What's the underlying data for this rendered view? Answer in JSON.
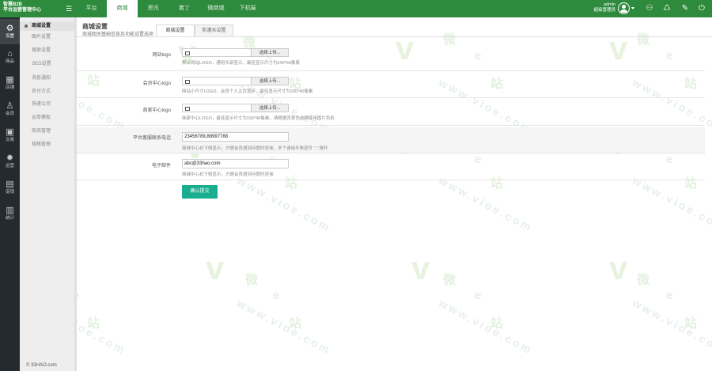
{
  "app": {
    "brand_line1": "智慧B2B",
    "brand_line2": "平台运营管理中心"
  },
  "top_nav": [
    {
      "label": "平台"
    },
    {
      "label": "商城",
      "active": true
    },
    {
      "label": "资讯"
    },
    {
      "label": "着丁"
    },
    {
      "label": "微商城"
    },
    {
      "label": "下机端"
    }
  ],
  "user": {
    "name": "admin",
    "role": "超级管理员"
  },
  "icons": {
    "menu": "menu-icon",
    "user": "user-avatar-icon",
    "a": "person-list-icon",
    "b": "bucket-icon",
    "c": "brush-icon",
    "d": "power-icon"
  },
  "icon_sidebar": [
    {
      "label": "设置",
      "icon": "gear-icon",
      "active": true
    },
    {
      "label": "商品",
      "icon": "shopping-basket-icon"
    },
    {
      "label": "店铺",
      "icon": "store-icon"
    },
    {
      "label": "会员",
      "icon": "user-icon"
    },
    {
      "label": "交易",
      "icon": "trade-icon"
    },
    {
      "label": "运营",
      "icon": "settings-icon"
    },
    {
      "label": "促销",
      "icon": "promotion-icon"
    },
    {
      "label": "统计",
      "icon": "chart-icon"
    }
  ],
  "sub_menu": [
    {
      "label": "商城设置",
      "active": true
    },
    {
      "label": "图片设置"
    },
    {
      "label": "搜索设置"
    },
    {
      "label": "SEO设置"
    },
    {
      "label": "消息通知"
    },
    {
      "label": "支付方式"
    },
    {
      "label": "快递公司"
    },
    {
      "label": "运单模板"
    },
    {
      "label": "商品管理"
    },
    {
      "label": "规格管理"
    }
  ],
  "sub_footer": "© 33HAO.com",
  "page": {
    "title": "商城设置",
    "subtitle": "商城相关基础信息及功能设置选项",
    "tabs": [
      {
        "label": "商城设置",
        "active": true
      },
      {
        "label": "防灌水设置"
      }
    ]
  },
  "form": {
    "logo_label": "网站logo",
    "logo_button": "选择上传...",
    "logo_hint": "默认网站LOGO，通用头部显示，最佳显示尺寸为240*60像素",
    "member_logo_label": "会员中心logo",
    "member_logo_button": "选择上传...",
    "member_logo_hint": "网站小尺寸LOGO，会员个人主页显示，最佳显示尺寸为200*40像素",
    "seller_logo_label": "商家中心logo",
    "seller_logo_button": "选择上传...",
    "seller_logo_hint": "商家中心LOGO，最佳显示尺寸为150*40像素，请根据背景色选择使用图片色彩",
    "phone_label": "平台客服联系电话",
    "phone_value": "23456789,88997788",
    "phone_hint": "商城中心右下侧显示，方便会员遇到问题时咨询，多个请用半角逗号 \",\" 隔开",
    "email_label": "电子邮件",
    "email_value": "abc@33hao.com",
    "email_hint": "商城中心右下侧显示，方便会员遇到问题时咨询",
    "submit": "确认提交"
  },
  "watermark": {
    "glyph": "v",
    "brand": "微",
    "letter": "e",
    "station": "站",
    "url": "www.vioe.com"
  }
}
